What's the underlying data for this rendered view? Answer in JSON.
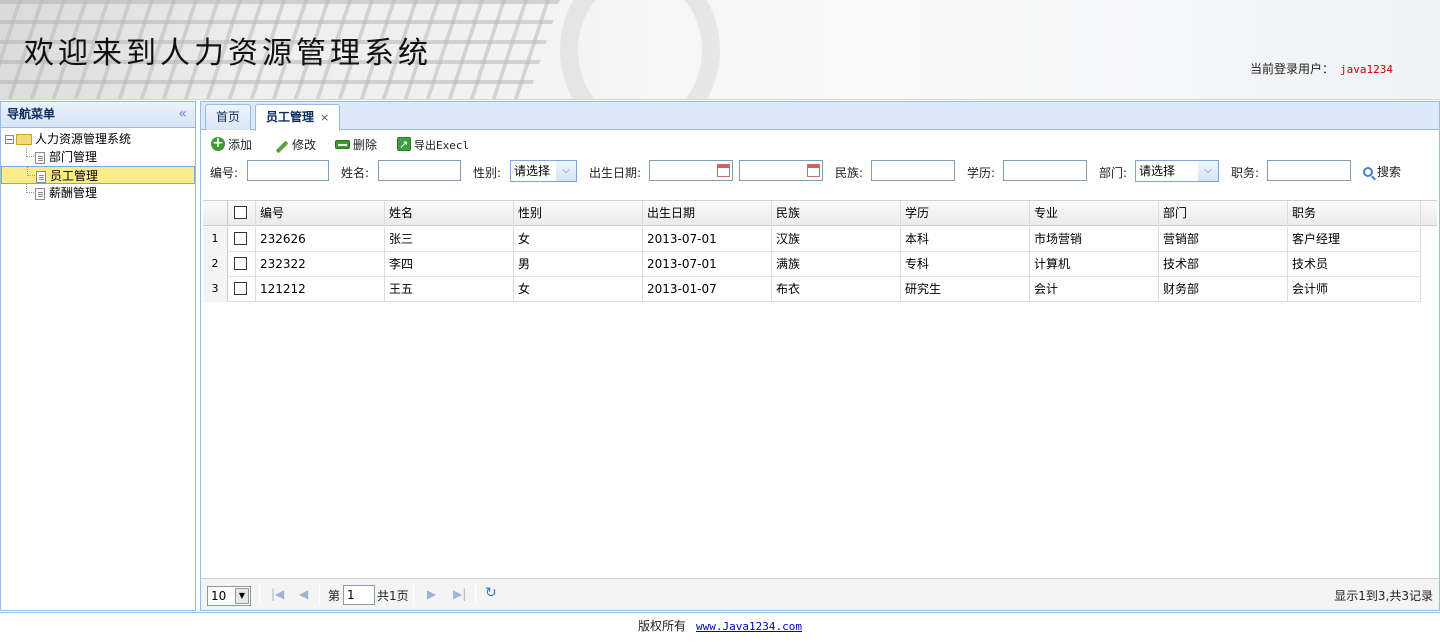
{
  "header": {
    "title": "欢迎来到人力资源管理系统",
    "user_label": "当前登录用户：",
    "user_name": "java1234"
  },
  "nav": {
    "title": "导航菜单",
    "collapse_icon": "double-chevron-left-icon",
    "root": "人力资源管理系统",
    "items": [
      {
        "label": "部门管理",
        "selected": false
      },
      {
        "label": "员工管理",
        "selected": true
      },
      {
        "label": "薪酬管理",
        "selected": false
      }
    ]
  },
  "tabs": [
    {
      "label": "首页",
      "active": false
    },
    {
      "label": "员工管理",
      "active": true,
      "close": "×"
    }
  ],
  "toolbar": {
    "add": "添加",
    "edit": "修改",
    "delete": "删除",
    "export": "导出Execl"
  },
  "search": {
    "id_label": "编号:",
    "name_label": "姓名:",
    "sex_label": "性别:",
    "sex_value": "请选择",
    "birth_label": "出生日期:",
    "nation_label": "民族:",
    "education_label": "学历:",
    "dept_label": "部门:",
    "dept_value": "请选择",
    "position_label": "职务:",
    "search_button": "搜索"
  },
  "table": {
    "columns": [
      "编号",
      "姓名",
      "性别",
      "出生日期",
      "民族",
      "学历",
      "专业",
      "部门",
      "职务"
    ],
    "rows": [
      {
        "num": "1",
        "cells": [
          "232626",
          "张三",
          "女",
          "2013-07-01",
          "汉族",
          "本科",
          "市场营销",
          "营销部",
          "客户经理"
        ]
      },
      {
        "num": "2",
        "cells": [
          "232322",
          "李四",
          "男",
          "2013-07-01",
          "满族",
          "专科",
          "计算机",
          "技术部",
          "技术员"
        ]
      },
      {
        "num": "3",
        "cells": [
          "121212",
          "王五",
          "女",
          "2013-01-07",
          "布衣",
          "研究生",
          "会计",
          "财务部",
          "会计师"
        ]
      }
    ]
  },
  "pager": {
    "page_size": "10",
    "page_prefix": "第",
    "page_value": "1",
    "page_total": "共1页",
    "info": "显示1到3,共3记录"
  },
  "footer": {
    "copyright": "版权所有",
    "link": "www.Java1234.com"
  },
  "colors": {
    "border": "#99bbe8",
    "selected_node": "#fbec88",
    "username": "#cc0000"
  }
}
